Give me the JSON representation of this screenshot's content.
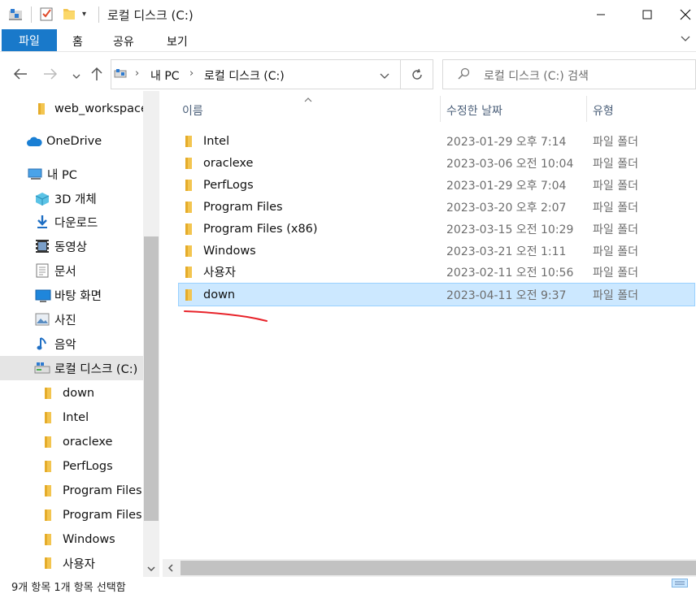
{
  "window": {
    "title": "로컬 디스크 (C:)",
    "minimize_glyph": "—",
    "maximize_glyph": "☐",
    "close_glyph": "✕"
  },
  "ribbon": {
    "tabs": [
      "파일",
      "홈",
      "공유",
      "보기"
    ],
    "expand_glyph": "⌄",
    "accent_color": "#1979ca"
  },
  "address": {
    "crumbs": [
      "내 PC",
      "로컬 디스크 (C:)"
    ],
    "search_placeholder": "로컬 디스크 (C:) 검색"
  },
  "sidebar": {
    "items": [
      {
        "label": "web_workspace",
        "icon": "folder-icon"
      },
      {
        "label": "OneDrive",
        "icon": "cloud-icon"
      },
      {
        "label": "내 PC",
        "icon": "pc-icon"
      },
      {
        "label": "3D 개체",
        "icon": "cube-icon"
      },
      {
        "label": "다운로드",
        "icon": "download-icon"
      },
      {
        "label": "동영상",
        "icon": "video-icon"
      },
      {
        "label": "문서",
        "icon": "document-icon"
      },
      {
        "label": "바탕 화면",
        "icon": "desktop-icon"
      },
      {
        "label": "사진",
        "icon": "picture-icon"
      },
      {
        "label": "음악",
        "icon": "music-icon"
      },
      {
        "label": "로컬 디스크 (C:)",
        "icon": "drive-icon"
      },
      {
        "label": "down",
        "icon": "folder-icon"
      },
      {
        "label": "Intel",
        "icon": "folder-icon"
      },
      {
        "label": "oraclexe",
        "icon": "folder-icon"
      },
      {
        "label": "PerfLogs",
        "icon": "folder-icon"
      },
      {
        "label": "Program Files",
        "icon": "folder-icon"
      },
      {
        "label": "Program Files (",
        "icon": "folder-icon"
      },
      {
        "label": "Windows",
        "icon": "folder-icon"
      },
      {
        "label": "사용자",
        "icon": "folder-icon"
      }
    ]
  },
  "columns": {
    "name": "이름",
    "date": "수정한 날짜",
    "type": "유형"
  },
  "files": [
    {
      "name": "Intel",
      "date": "2023-01-29 오후 7:14",
      "type": "파일 폴더"
    },
    {
      "name": "oraclexe",
      "date": "2023-03-06 오전 10:04",
      "type": "파일 폴더"
    },
    {
      "name": "PerfLogs",
      "date": "2023-01-29 오후 7:04",
      "type": "파일 폴더"
    },
    {
      "name": "Program Files",
      "date": "2023-03-20 오후 2:07",
      "type": "파일 폴더"
    },
    {
      "name": "Program Files (x86)",
      "date": "2023-03-15 오전 10:29",
      "type": "파일 폴더"
    },
    {
      "name": "Windows",
      "date": "2023-03-21 오전 1:11",
      "type": "파일 폴더"
    },
    {
      "name": "사용자",
      "date": "2023-02-11 오전 10:56",
      "type": "파일 폴더"
    },
    {
      "name": "down",
      "date": "2023-04-11 오전 9:37",
      "type": "파일 폴더",
      "selected": true
    }
  ],
  "status": {
    "text": "9개 항목    1개 항목 선택함"
  },
  "annotation": {
    "color": "#e8232a"
  }
}
